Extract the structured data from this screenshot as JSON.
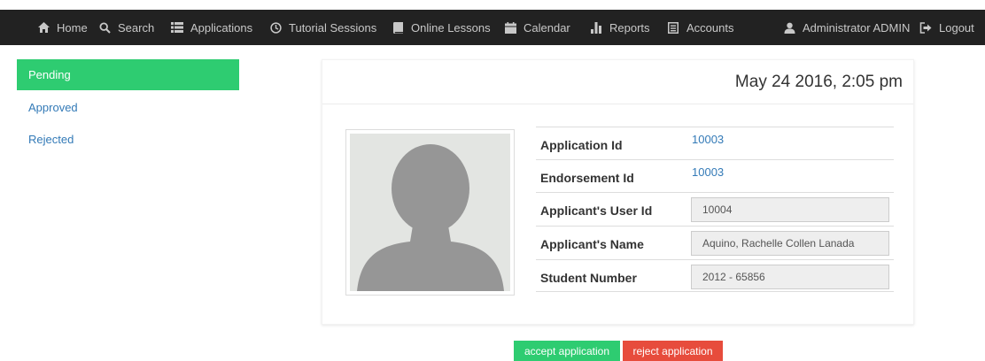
{
  "nav": {
    "items": [
      {
        "label": "Home",
        "icon": "home-icon"
      },
      {
        "label": "Search",
        "icon": "search-icon"
      },
      {
        "label": "Applications",
        "icon": "list-icon"
      },
      {
        "label": "Tutorial Sessions",
        "icon": "clock-icon"
      },
      {
        "label": "Online Lessons",
        "icon": "book-icon"
      },
      {
        "label": "Calendar",
        "icon": "calendar-icon"
      },
      {
        "label": "Reports",
        "icon": "bar-chart-icon"
      },
      {
        "label": "Accounts",
        "icon": "accounts-icon"
      }
    ],
    "user": {
      "label": "Administrator ADMIN",
      "icon": "user-icon"
    },
    "logout": {
      "label": "Logout",
      "icon": "logout-icon"
    }
  },
  "sidebar": {
    "items": [
      {
        "label": "Pending",
        "active": true
      },
      {
        "label": "Approved",
        "active": false
      },
      {
        "label": "Rejected",
        "active": false
      }
    ]
  },
  "panel": {
    "timestamp": "May 24 2016, 2:05 pm",
    "avatar_icon": "default-avatar-icon",
    "fields": [
      {
        "label": "Application Id",
        "value": "10003"
      },
      {
        "label": "Endorsement Id",
        "value": "10003"
      },
      {
        "label": "Applicant's User Id",
        "value": "10004"
      },
      {
        "label": "Applicant's Name",
        "value": "Aquino, Rachelle Collen Lanada"
      },
      {
        "label": "Student Number",
        "value": "2012 - 65856"
      }
    ]
  },
  "actions": {
    "accept_label": "accept application",
    "reject_label": "reject application"
  },
  "colors": {
    "navbar_bg": "#222222",
    "accent_green": "#2ecc71",
    "danger_red": "#e74c3c",
    "link_blue": "#337ab7"
  }
}
